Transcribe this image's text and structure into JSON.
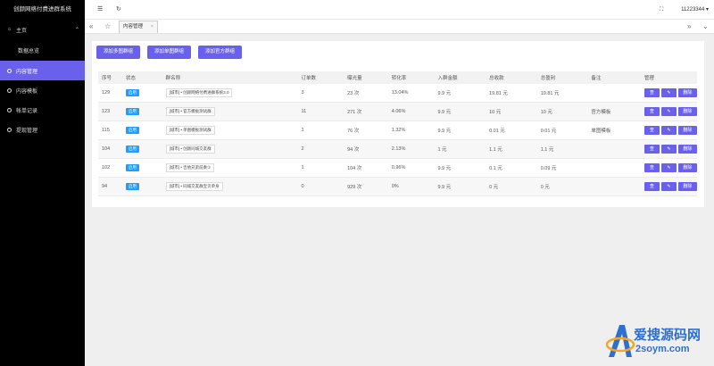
{
  "app_title": "创颜网络付费进群系统",
  "sidebar": {
    "home": "主页",
    "dashboard": "数据总览",
    "items": [
      {
        "label": "内容管理",
        "active": true
      },
      {
        "label": "内容模板",
        "active": false
      },
      {
        "label": "帐单记录",
        "active": false
      },
      {
        "label": "提现管理",
        "active": false
      }
    ]
  },
  "topbar": {
    "menu_icon": "☰",
    "refresh_icon": "↻",
    "fullscreen_icon": "⛶",
    "username": "11223344",
    "user_caret": "▾"
  },
  "tabbar": {
    "prev_icon": "«",
    "home_icon": "☆",
    "tab_label": "内容管理",
    "tab_close": "×",
    "next_icon": "»",
    "more_icon": "⌄"
  },
  "actions": {
    "add_multi": "添加多图群组",
    "add_single": "添加单图群组",
    "add_official": "添加官方群组"
  },
  "table": {
    "headers": [
      "序号",
      "状态",
      "群名称",
      "订单数",
      "曝光量",
      "转化率",
      "入群金额",
      "总收款",
      "总盈利",
      "备注",
      "管理"
    ],
    "rows": [
      {
        "id": "129",
        "status": "启用",
        "name": "[城市] • 创颜网络付费进群系统3.0",
        "orders": "3",
        "views": "23 次",
        "rate": "13.04%",
        "price": "9.9 元",
        "total": "19.81 元",
        "profit": "19.81 元",
        "note": ""
      },
      {
        "id": "123",
        "status": "启用",
        "name": "[城市] • 官方模板测试群",
        "orders": "11",
        "views": "271 次",
        "rate": "4.06%",
        "price": "9.9 元",
        "total": "10 元",
        "profit": "10 元",
        "note": "官方模板"
      },
      {
        "id": "115",
        "status": "启用",
        "name": "[城市] • 单图模板测试群",
        "orders": "1",
        "views": "76 次",
        "rate": "1.32%",
        "price": "9.9 元",
        "total": "0.01 元",
        "profit": "0.01 元",
        "note": "单图模板"
      },
      {
        "id": "104",
        "status": "启用",
        "name": "[城市] • 创颜同城交友群",
        "orders": "2",
        "views": "94 次",
        "rate": "2.13%",
        "price": "1 元",
        "total": "1.1 元",
        "profit": "1.1 元",
        "note": ""
      },
      {
        "id": "102",
        "status": "启用",
        "name": "[城市] • 吉他兄弟前奏①",
        "orders": "1",
        "views": "104 次",
        "rate": "0.96%",
        "price": "9.9 元",
        "total": "0.1 元",
        "profit": "0.09 元",
        "note": ""
      },
      {
        "id": "94",
        "status": "启用",
        "name": "[城市] • 同城交友群宝贝单身",
        "orders": "0",
        "views": "929 次",
        "rate": "0%",
        "price": "9.9 元",
        "total": "0 元",
        "profit": "0 元",
        "note": ""
      }
    ],
    "op_view": "查",
    "op_edit": "✎",
    "op_delete": "删除"
  },
  "watermark": {
    "text": "爱搜源码网",
    "sub": "2soym.com"
  },
  "colors": {
    "accent": "#6960ec",
    "badge": "#1e9fff",
    "sidebar_bg": "#000000"
  }
}
